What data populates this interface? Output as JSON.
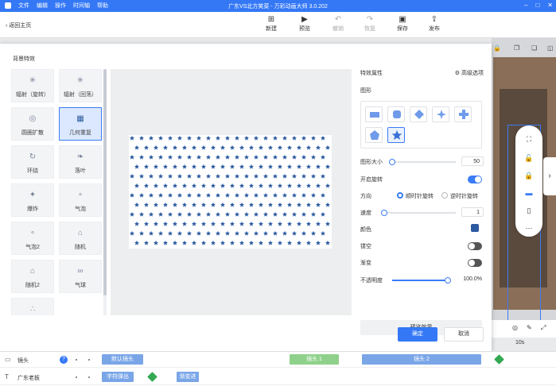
{
  "titlebar": {
    "menu": [
      "文件",
      "编辑",
      "操作",
      "时间轴",
      "帮助"
    ],
    "title": "广东VS北方笑菜 - 万彩动画大师 3.0.202"
  },
  "toolbar": {
    "back_label": "返回主页",
    "buttons": [
      {
        "label": "新建",
        "icon": "plus-icon"
      },
      {
        "label": "预览",
        "icon": "play-icon"
      },
      {
        "label": "撤销",
        "icon": "undo-icon"
      },
      {
        "label": "恢复",
        "icon": "redo-icon"
      },
      {
        "label": "保存",
        "icon": "save-icon"
      },
      {
        "label": "发布",
        "icon": "publish-icon"
      }
    ]
  },
  "dialog": {
    "title": "背景特效",
    "effects": [
      {
        "label": "辐射（旋转）",
        "icon": "radial-rotate-icon"
      },
      {
        "label": "辐射（回荡）",
        "icon": "radial-swing-icon"
      },
      {
        "label": "圆圈扩散",
        "icon": "circle-spread-icon"
      },
      {
        "label": "几何重复",
        "icon": "geometric-repeat-icon"
      },
      {
        "label": "环绕",
        "icon": "orbit-icon"
      },
      {
        "label": "落叶",
        "icon": "falling-leaf-icon"
      },
      {
        "label": "爆炸",
        "icon": "explosion-icon"
      },
      {
        "label": "气泡",
        "icon": "bubble-icon"
      },
      {
        "label": "气泡2",
        "icon": "bubble2-icon"
      },
      {
        "label": "随机",
        "icon": "random-icon"
      },
      {
        "label": "随机2",
        "icon": "random2-icon"
      },
      {
        "label": "气球",
        "icon": "balloon-icon"
      },
      {
        "label": "",
        "icon": "more-effect-icon"
      }
    ],
    "selected_effect": "几何重复",
    "pattern_color": "#2c5aa0",
    "props": {
      "title": "特效属性",
      "advanced": "高级选项",
      "shape_label": "图形",
      "shapes": [
        "rectangle-shape-icon",
        "rounded-square-shape-icon",
        "diamond-shape-icon",
        "sparkle-shape-icon",
        "cross-shape-icon",
        "pentagon-shape-icon",
        "star-shape-icon"
      ],
      "selected_shape": "star-shape-icon",
      "size_label": "图形大小",
      "size_value": "50",
      "rotate_label": "开启旋转",
      "rotate_on": true,
      "direction_label": "方向",
      "dir_cw": "顺时针旋转",
      "dir_ccw": "逆时针旋转",
      "speed_label": "速度",
      "speed_value": "1",
      "color_label": "颜色",
      "hollow_label": "镂空",
      "gradient_label": "渐变",
      "opacity_label": "不透明度",
      "opacity_value": "100.0%",
      "preview_button": "预览效果"
    },
    "ok": "确定",
    "cancel": "取消"
  },
  "timeline": {
    "time_marker": "10s",
    "rows": [
      {
        "name": "镜头",
        "clips": [
          "默认镜头",
          "镜头 1",
          "镜头 2"
        ]
      },
      {
        "name": "广东老板",
        "clips": [
          "字符弹出",
          "渐变进"
        ]
      }
    ]
  },
  "colors": {
    "accent": "#3478f6",
    "green_clip": "#8fd18a",
    "blue_clip": "#7aa6e8"
  }
}
